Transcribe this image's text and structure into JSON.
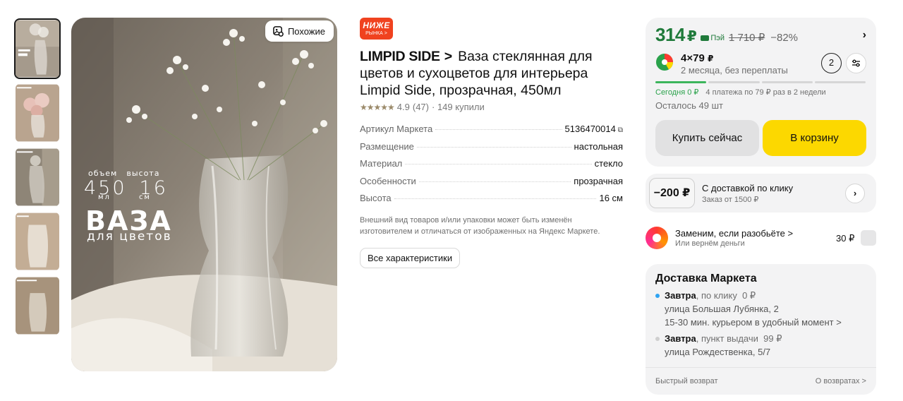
{
  "gallery": {
    "similar_label": "Похожие",
    "overlay": {
      "label_volume": "объем",
      "label_height": "высота",
      "volume": "450",
      "height": "16",
      "unit_volume": "мл",
      "unit_height": "см",
      "title": "ВАЗА",
      "subtitle": "для цветов"
    }
  },
  "product": {
    "badge_line1": "НИЖЕ",
    "badge_line2": "РЫНКА >",
    "brand": "LIMPID SIDE",
    "brand_chevron": ">",
    "title": "Ваза стеклянная для цветов и сухоцветов для интерьера Limpid Side, прозрачная, 450мл",
    "rating_stars": "★★★★★",
    "rating": "4.9",
    "reviews": "(47)",
    "purchases": "· 149 купили",
    "specs": [
      {
        "key": "Артикул Маркета",
        "value": "5136470014"
      },
      {
        "key": "Размещение",
        "value": "настольная"
      },
      {
        "key": "Материал",
        "value": "стекло"
      },
      {
        "key": "Особенности",
        "value": "прозрачная"
      },
      {
        "key": "Высота",
        "value": "16 см"
      }
    ],
    "disclaimer": "Внешний вид товаров и/или упаковки может быть изменён изготовителем и отличаться от изображенных на Яндекс Маркете.",
    "all_specs_button": "Все характеристики"
  },
  "buy": {
    "price": "314",
    "currency": "₽",
    "pay_label": "Пэй",
    "old_price": "1 710 ₽",
    "discount": "−82%",
    "split_price": "4×79",
    "split_desc": "2 месяца, без переплаты",
    "split_count": "2",
    "progress_segments_total": 4,
    "progress_segments_done": 1,
    "schedule_today": "Сегодня 0 ₽",
    "schedule_rest": "4 платежа по 79 ₽ раз в 2 недели",
    "stock": "Осталось 49 шт",
    "buy_now": "Купить сейчас",
    "add_to_cart": "В корзину",
    "accent_color": "#1f7a3a",
    "cart_color": "#fcd800"
  },
  "coupon": {
    "value": "−200 ₽",
    "title": "С доставкой по клику",
    "subtitle": "Заказ от 1500 ₽"
  },
  "insurance": {
    "title": "Заменим, если разобьёте >",
    "subtitle": "Или вернём деньги",
    "price": "30 ₽"
  },
  "delivery": {
    "title": "Доставка Маркета",
    "option1_day": "Завтра",
    "option1_method": ", по клику",
    "option1_price": "0 ₽",
    "option1_address": "улица Большая Лубянка, 2",
    "option1_note": "15-30 мин. курьером в удобный момент >",
    "option2_day": "Завтра",
    "option2_method": ", пункт выдачи",
    "option2_price": "99 ₽",
    "option2_address": "улица Рождественка, 5/7",
    "footer_left": "Быстрый возврат",
    "footer_right": "О возвратах >"
  }
}
